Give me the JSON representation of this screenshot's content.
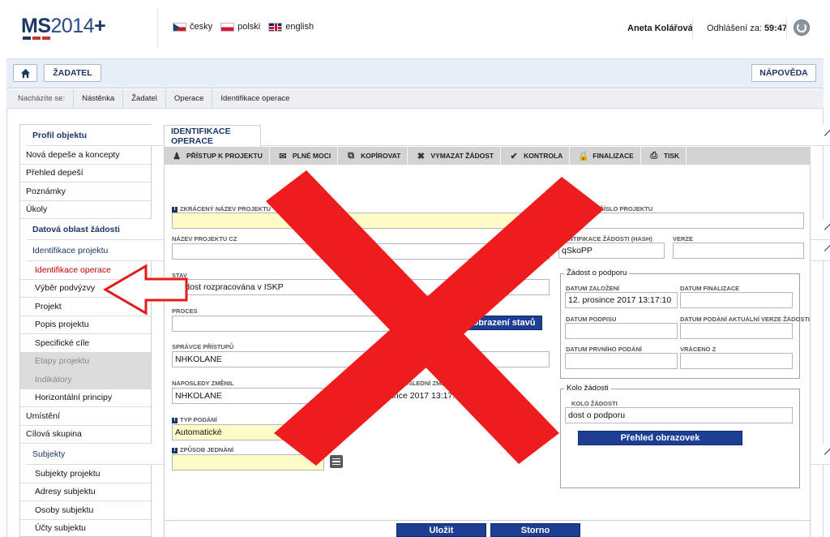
{
  "header": {
    "logo_main": "MS",
    "logo_year": "2014",
    "logo_plus": "+",
    "languages": [
      {
        "label": "česky",
        "flag": "cz-flag-icon"
      },
      {
        "label": "polski",
        "flag": "pl-flag-icon"
      },
      {
        "label": "english",
        "flag": "gb-flag-icon"
      }
    ],
    "user_name": "Aneta Kolářová",
    "logout_label": "Odhlášení za:",
    "logout_time": "59:47"
  },
  "toolbar": {
    "home_icon": "home-icon",
    "zadatel_label": "ŽADATEL",
    "help_label": "NÁPOVĚDA"
  },
  "breadcrumb": {
    "label": "Nacházíte se:",
    "items": [
      "Nástěnka",
      "Žadatel",
      "Operace",
      "Identifikace operace"
    ]
  },
  "sidebar": {
    "items": [
      {
        "label": "Profil objektu",
        "type": "header"
      },
      {
        "label": "Nová depeše a koncepty",
        "type": "item"
      },
      {
        "label": "Přehled depeší",
        "type": "item"
      },
      {
        "label": "Poznámky",
        "type": "item"
      },
      {
        "label": "Úkoly",
        "type": "item"
      },
      {
        "label": "Datová oblast žádosti",
        "type": "header"
      },
      {
        "label": "Identifikace projektu",
        "type": "header-light"
      },
      {
        "label": "Identifikace operace",
        "type": "sub-active"
      },
      {
        "label": "Výběr podvýzvy",
        "type": "sub"
      },
      {
        "label": "Projekt",
        "type": "sub"
      },
      {
        "label": "Popis projektu",
        "type": "sub"
      },
      {
        "label": "Specifické cíle",
        "type": "sub"
      },
      {
        "label": "Etapy projektu",
        "type": "sub-disabled"
      },
      {
        "label": "Indikátory",
        "type": "sub-disabled"
      },
      {
        "label": "Horizontální principy",
        "type": "sub"
      },
      {
        "label": "Umístění",
        "type": "item"
      },
      {
        "label": "Cílová skupina",
        "type": "item"
      },
      {
        "label": "Subjekty",
        "type": "header-light"
      },
      {
        "label": "Subjekty projektu",
        "type": "sub"
      },
      {
        "label": "Adresy subjektu",
        "type": "sub"
      },
      {
        "label": "Osoby subjektu",
        "type": "sub"
      },
      {
        "label": "Účty subjektu",
        "type": "sub"
      }
    ]
  },
  "main": {
    "tab_label": "IDENTIFIKACE OPERACE",
    "actions": [
      {
        "label": "PŘÍSTUP K PROJEKTU",
        "icon": "people-icon"
      },
      {
        "label": "PLNÉ MOCI",
        "icon": "envelope-icon"
      },
      {
        "label": "KOPÍROVAT",
        "icon": "copy-icon"
      },
      {
        "label": "VYMAZAT ŽÁDOST",
        "icon": "delete-icon"
      },
      {
        "label": "KONTROLA",
        "icon": "check-icon"
      },
      {
        "label": "FINALIZACE",
        "icon": "lock-icon"
      },
      {
        "label": "TISK",
        "icon": "printer-icon"
      }
    ],
    "fields": {
      "short_name_label": "ZKRÁCENÝ NÁZEV PROJEKTU",
      "short_name_value": "",
      "name_cz_label": "NÁZEV PROJEKTU CZ",
      "name_cz_value": "",
      "status_label": "STAV",
      "status_value": "Žádost rozpracována v ISKP",
      "process_label": "PROCES",
      "process_value": "",
      "status_view_button": "obrazení stavů",
      "access_admin_label": "SPRÁVCE PŘÍSTUPŮ",
      "access_admin_value": "NHKOLANE",
      "last_changed_label": "NAPOSLEDY ZMĚNIL",
      "last_changed_value": "NHKOLANE",
      "last_change_date_label": "POSLEDNÍ ZMĚNY",
      "last_change_date_value": "rosince 2017 13:17:12",
      "submit_type_label": "TYP PODÁNÍ",
      "submit_type_value": "Automatické",
      "method_label": "ZPŮSOB JEDNÁNÍ",
      "method_value": "",
      "reg_number_label": "AČNÍ ČÍSLO PROJEKTU",
      "reg_number_value": "",
      "hash_label": "IDENTIFIKACE ŽÁDOSTI (HASH)",
      "hash_value": "qSkoPP",
      "version_label": "VERZE",
      "version_value": ""
    },
    "support_group": {
      "title": "Žádost o podporu",
      "created_label": "DATUM ZALOŽENÍ",
      "created_value": "12. prosince 2017 13:17:10",
      "finalized_label": "DATUM FINALIZACE",
      "finalized_value": "",
      "signed_label": "DATUM PODPISU",
      "signed_value": "",
      "last_submit_label": "DATUM PODÁNÍ AKTUÁLNÍ VERZE ŽÁDOSTI",
      "last_submit_value": "",
      "first_submit_label": "DATUM PRVNÍHO PODÁNÍ",
      "first_submit_value": "",
      "returned_label": "VRÁCENO Z",
      "returned_value": ""
    },
    "round_group": {
      "title": "Kolo žádosti",
      "round_label": "KOLO ŽÁDOSTI",
      "round_value": "dost o podporu",
      "screens_button": "Přehled obrazovek"
    },
    "save_button": "Uložit",
    "cancel_button": "Storno"
  },
  "colors": {
    "brand": "#1c3667",
    "button_blue": "#1d3f93",
    "active_red": "#c00000",
    "required_yellow": "#fffcc8",
    "overlay_red": "#ee1c1c"
  }
}
